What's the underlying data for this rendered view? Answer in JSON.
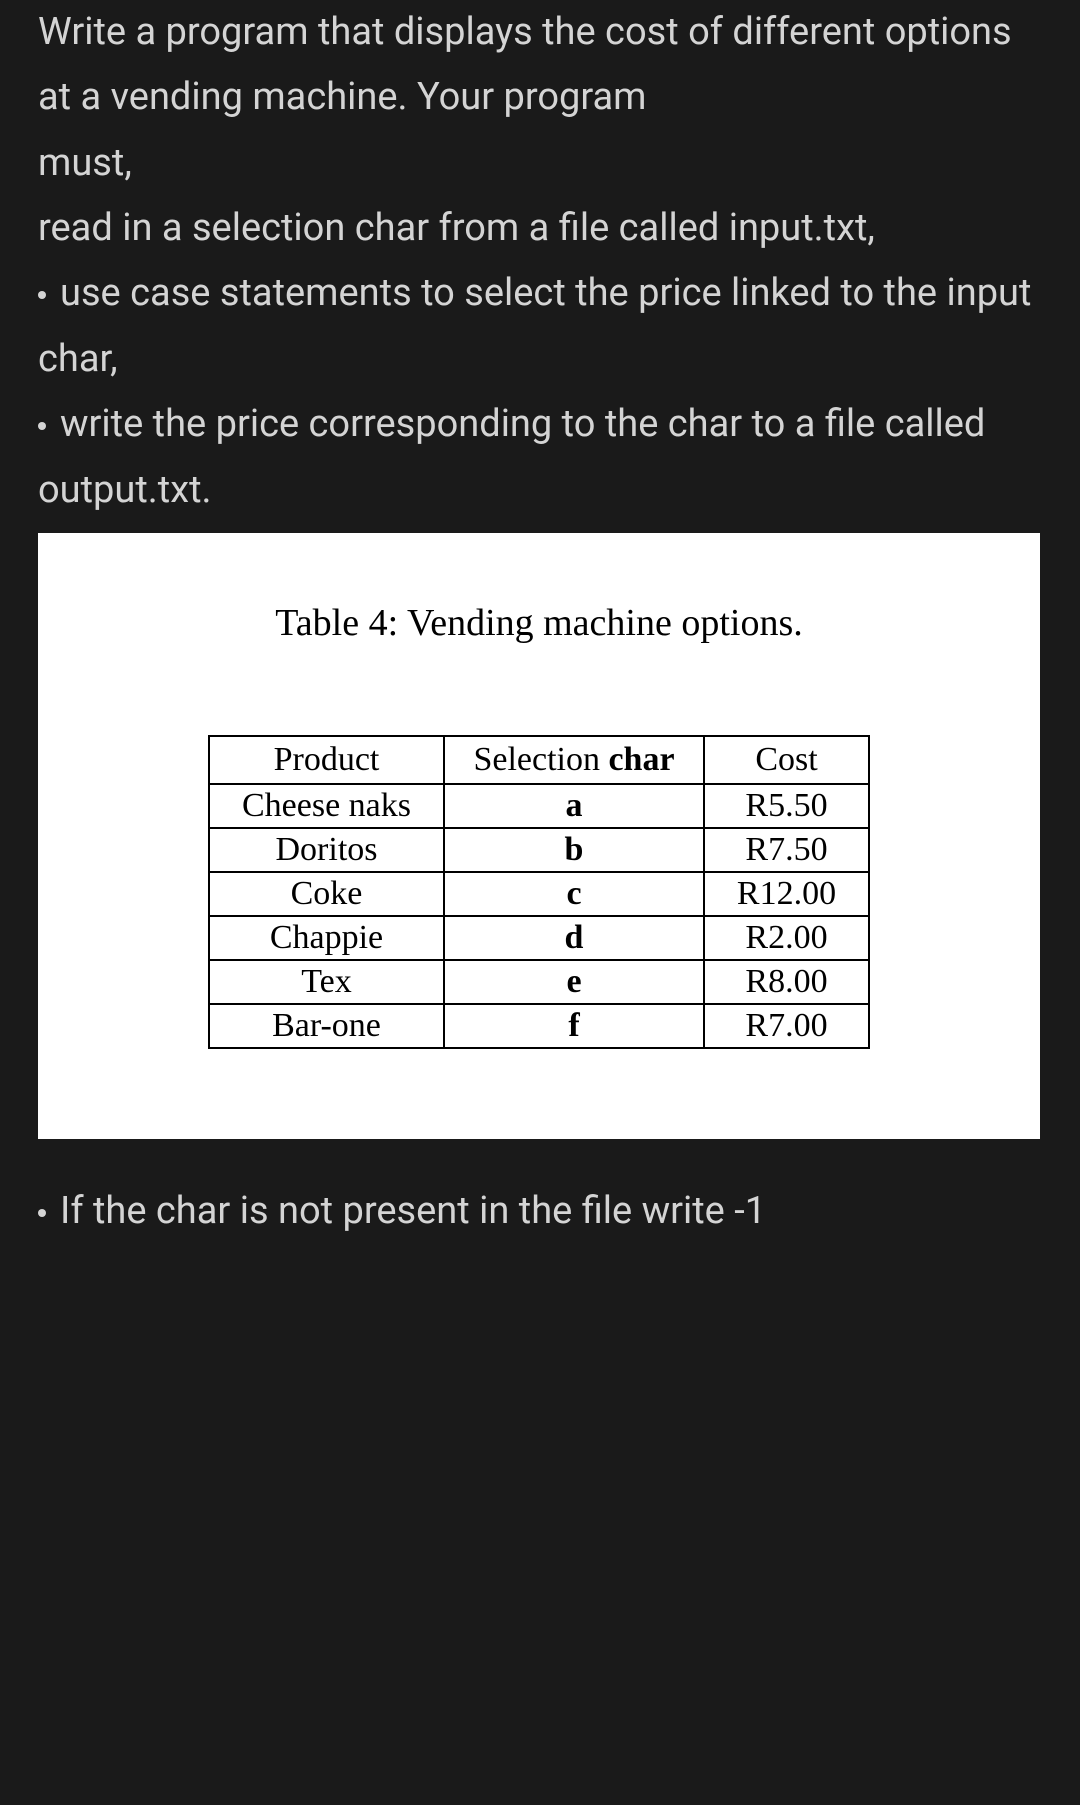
{
  "instructions": {
    "line1": "Write a program that displays the cost of different options at a vending machine. Your program",
    "line2": "must,",
    "line3": "read in a selection char from a file called input.txt,",
    "bullet1": "use case statements to select the price linked to the input char,",
    "bullet2": "write the price corresponding to the char to a file called output.txt.",
    "bullet3": "If the char is not present in the file write -1"
  },
  "table": {
    "caption_prefix": "Table 4: ",
    "caption_text": "Vending machine options.",
    "headers": {
      "product": "Product",
      "char_prefix": "Selection ",
      "char_bold": "char",
      "cost": "Cost"
    },
    "rows": [
      {
        "product": "Cheese naks",
        "char": "a",
        "cost": "R5.50"
      },
      {
        "product": "Doritos",
        "char": "b",
        "cost": "R7.50"
      },
      {
        "product": "Coke",
        "char": "c",
        "cost": "R12.00"
      },
      {
        "product": "Chappie",
        "char": "d",
        "cost": "R2.00"
      },
      {
        "product": "Tex",
        "char": "e",
        "cost": "R8.00"
      },
      {
        "product": "Bar-one",
        "char": "f",
        "cost": "R7.00"
      }
    ]
  }
}
